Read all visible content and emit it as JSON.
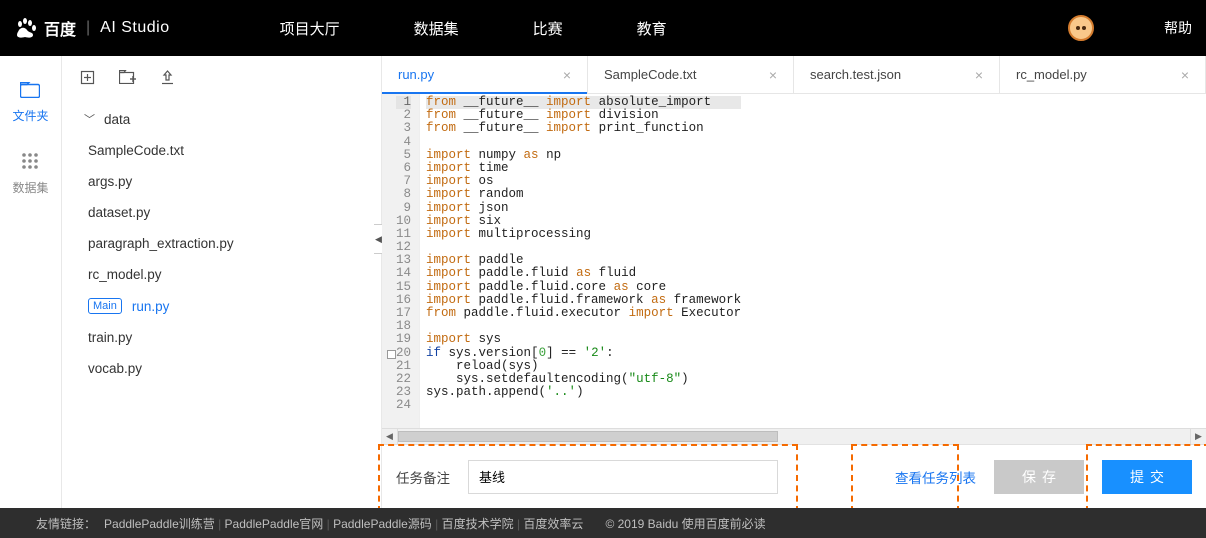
{
  "top": {
    "brand_main": "百度",
    "brand_sub": "AI Studio",
    "nav": [
      "项目大厅",
      "数据集",
      "比赛",
      "教育"
    ],
    "help": "帮助"
  },
  "rail": {
    "files": "文件夹",
    "datasets": "数据集"
  },
  "explorer": {
    "folder": "data",
    "files": [
      "SampleCode.txt",
      "args.py",
      "dataset.py",
      "paragraph_extraction.py",
      "rc_model.py",
      "run.py",
      "train.py",
      "vocab.py"
    ],
    "main_badge": "Main",
    "active_index": 5
  },
  "tabs": [
    {
      "label": "run.py",
      "active": true
    },
    {
      "label": "SampleCode.txt",
      "active": false
    },
    {
      "label": "search.test.json",
      "active": false
    },
    {
      "label": "rc_model.py",
      "active": false
    }
  ],
  "code": {
    "lines": [
      {
        "n": 1,
        "html": "<span class='kw-orange'>from</span> __future__ <span class='kw-orange'>import</span> absolute_import",
        "hl": true
      },
      {
        "n": 2,
        "html": "<span class='kw-orange'>from</span> __future__ <span class='kw-orange'>import</span> division"
      },
      {
        "n": 3,
        "html": "<span class='kw-orange'>from</span> __future__ <span class='kw-orange'>import</span> print_function"
      },
      {
        "n": 4,
        "html": ""
      },
      {
        "n": 5,
        "html": "<span class='kw-orange'>import</span> numpy <span class='kw-orange'>as</span> np"
      },
      {
        "n": 6,
        "html": "<span class='kw-orange'>import</span> time"
      },
      {
        "n": 7,
        "html": "<span class='kw-orange'>import</span> os"
      },
      {
        "n": 8,
        "html": "<span class='kw-orange'>import</span> random"
      },
      {
        "n": 9,
        "html": "<span class='kw-orange'>import</span> json"
      },
      {
        "n": 10,
        "html": "<span class='kw-orange'>import</span> six"
      },
      {
        "n": 11,
        "html": "<span class='kw-orange'>import</span> multiprocessing"
      },
      {
        "n": 12,
        "html": ""
      },
      {
        "n": 13,
        "html": "<span class='kw-orange'>import</span> paddle"
      },
      {
        "n": 14,
        "html": "<span class='kw-orange'>import</span> paddle.fluid <span class='kw-orange'>as</span> fluid"
      },
      {
        "n": 15,
        "html": "<span class='kw-orange'>import</span> paddle.fluid.core <span class='kw-orange'>as</span> core"
      },
      {
        "n": 16,
        "html": "<span class='kw-orange'>import</span> paddle.fluid.framework <span class='kw-orange'>as</span> framework"
      },
      {
        "n": 17,
        "html": "<span class='kw-orange'>from</span> paddle.fluid.executor <span class='kw-orange'>import</span> Executor"
      },
      {
        "n": 18,
        "html": ""
      },
      {
        "n": 19,
        "html": "<span class='kw-orange'>import</span> sys"
      },
      {
        "n": 20,
        "html": "<span class='kw-blue'>if</span> sys.version[<span class='num'>0</span>] == <span class='str'>'2'</span>:",
        "fold": true
      },
      {
        "n": 21,
        "html": "    reload(sys)"
      },
      {
        "n": 22,
        "html": "    sys.setdefaultencoding(<span class='str'>\"utf-8\"</span>)"
      },
      {
        "n": 23,
        "html": "sys.path.append(<span class='str'>'..'</span>)"
      },
      {
        "n": 24,
        "html": ""
      }
    ]
  },
  "bottom": {
    "remark_label": "任务备注",
    "remark_value": "基线",
    "view_tasks": "查看任务列表",
    "save": "保存",
    "submit": "提交"
  },
  "footer": {
    "label": "友情链接：",
    "links": [
      "PaddlePaddle训练营",
      "PaddlePaddle官网",
      "PaddlePaddle源码",
      "百度技术学院",
      "百度效率云"
    ],
    "copyright": "© 2019 Baidu 使用百度前必读"
  }
}
